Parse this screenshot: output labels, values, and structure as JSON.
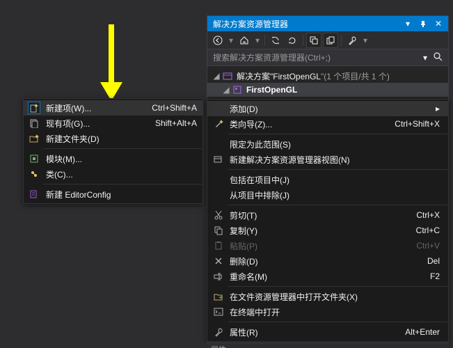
{
  "arrow": {
    "color": "#ffff00"
  },
  "contextMenu": {
    "items": [
      {
        "label": "新建项(W)...",
        "shortcut": "Ctrl+Shift+A",
        "icon": "new-item",
        "highlighted": true
      },
      {
        "label": "现有项(G)...",
        "shortcut": "Shift+Alt+A",
        "icon": "existing-item"
      },
      {
        "label": "新建文件夹(D)",
        "shortcut": "",
        "icon": "new-folder"
      },
      {
        "sep": true
      },
      {
        "label": "模块(M)...",
        "shortcut": "",
        "icon": "module"
      },
      {
        "label": "类(C)...",
        "shortcut": "",
        "icon": "class"
      },
      {
        "sep": true
      },
      {
        "label": "新建 EditorConfig",
        "shortcut": "",
        "icon": "editorconfig"
      }
    ]
  },
  "panel": {
    "title": "解决方案资源管理器",
    "searchPlaceholder": "搜索解决方案资源管理器(Ctrl+;)",
    "tree": {
      "solution": {
        "prefix": "解决方案\"",
        "name": "FirstOpenGL",
        "suffix": "\"(1 个项目/共 1 个)"
      },
      "project": "FirstOpenGL"
    }
  },
  "panelContext": {
    "items": [
      {
        "label": "添加(D)",
        "arrow": true,
        "highlighted": true
      },
      {
        "label": "类向导(Z)...",
        "shortcut": "Ctrl+Shift+X",
        "icon": "wizard"
      },
      {
        "sep": true
      },
      {
        "label": "限定为此范围(S)"
      },
      {
        "label": "新建解决方案资源管理器视图(N)",
        "icon": "new-view"
      },
      {
        "sep": true
      },
      {
        "label": "包括在项目中(J)"
      },
      {
        "label": "从项目中排除(J)"
      },
      {
        "sep": true
      },
      {
        "label": "剪切(T)",
        "shortcut": "Ctrl+X",
        "icon": "cut"
      },
      {
        "label": "复制(Y)",
        "shortcut": "Ctrl+C",
        "icon": "copy"
      },
      {
        "label": "粘贴(P)",
        "shortcut": "Ctrl+V",
        "icon": "paste",
        "disabled": true
      },
      {
        "label": "删除(D)",
        "shortcut": "Del",
        "icon": "delete"
      },
      {
        "label": "重命名(M)",
        "shortcut": "F2",
        "icon": "rename"
      },
      {
        "sep": true
      },
      {
        "label": "在文件资源管理器中打开文件夹(X)",
        "icon": "open-folder"
      },
      {
        "label": "在终端中打开",
        "icon": "terminal"
      },
      {
        "sep": true
      },
      {
        "label": "属性(R)",
        "shortcut": "Alt+Enter",
        "icon": "properties"
      }
    ]
  },
  "bottomTab": "属性"
}
